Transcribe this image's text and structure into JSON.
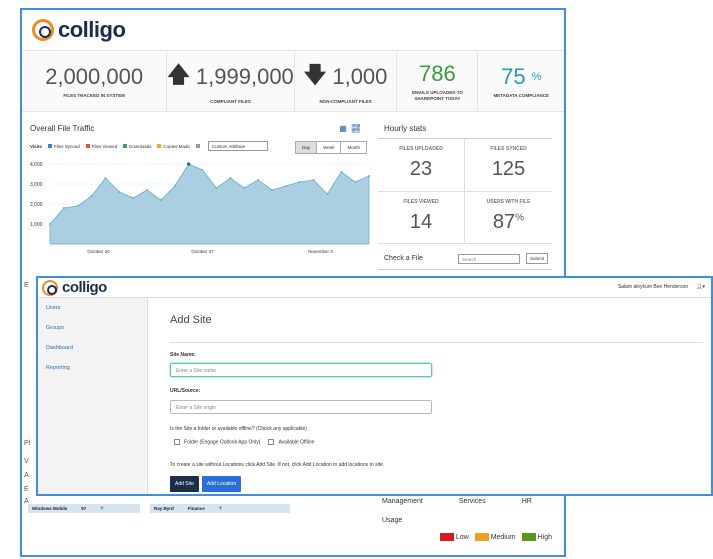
{
  "dashboard": {
    "logo": "colligo",
    "kpis": [
      {
        "value": "2,000,000",
        "label": "FILES TRACKED IN SYSTEM",
        "arrow": ""
      },
      {
        "value": "1,999,000",
        "label": "COMPLIANT FILES",
        "arrow": "🡅"
      },
      {
        "value": "1,000",
        "label": "NON-COMPLIANT FILES",
        "arrow": "🡇"
      },
      {
        "value": "786",
        "label": "EMAILS UPLOADED TO SHAREPOINT TODAY",
        "arrow": ""
      },
      {
        "value": "75",
        "suffix": "%",
        "label": "METADATA COMPLIANCE",
        "arrow": ""
      }
    ],
    "traffic": {
      "title": "Overall File Traffic",
      "legend_title": "Visits",
      "legend": [
        {
          "label": "Files Synced",
          "color": "#3a7bd5"
        },
        {
          "label": "Files Viewed",
          "color": "#e0533a"
        },
        {
          "label": "Downloads",
          "color": "#3aa35a"
        },
        {
          "label": "Copies Made",
          "color": "#f0a830"
        },
        {
          "label": "",
          "color": "#999999"
        }
      ],
      "attribute": "Custom Attribute",
      "ranges": [
        "Day",
        "Week",
        "Month"
      ]
    },
    "hourly": {
      "title": "Hourly stats",
      "cells": [
        {
          "label": "FILES UPLOADED",
          "value": "23",
          "suffix": ""
        },
        {
          "label": "FILES SYNCED",
          "value": "125",
          "suffix": ""
        },
        {
          "label": "FILES VIEWED",
          "value": "14",
          "suffix": ""
        },
        {
          "label": "USERS WITH FILE",
          "value": "87",
          "suffix": "%"
        }
      ],
      "check_label": "Check a File",
      "search_placeholder": "Search",
      "submit": "Submit"
    },
    "left_fragments": [
      "E",
      "Pl",
      "V",
      "A",
      "E",
      "A"
    ],
    "bottom_rows": [
      {
        "name": "Windows Mobile",
        "value": "97"
      },
      {
        "name": "Ray Byrd",
        "value": "Finance"
      }
    ],
    "usage": {
      "columns": [
        "Management",
        "Services",
        "HR"
      ],
      "label": "Usage",
      "legend": [
        {
          "label": "Low",
          "color": "#d91a1a"
        },
        {
          "label": "Medium",
          "color": "#f0a020"
        },
        {
          "label": "High",
          "color": "#5a9a1a"
        }
      ]
    }
  },
  "chart_data": {
    "type": "area",
    "x": [
      0,
      1,
      2,
      3,
      4,
      5,
      6,
      7,
      8,
      9,
      10,
      11,
      12,
      13,
      14,
      15,
      16,
      17,
      18,
      19,
      20,
      21,
      22,
      23
    ],
    "series": [
      {
        "values": [
          1000,
          1800,
          1900,
          2400,
          3300,
          2600,
          2300,
          2700,
          2200,
          2900,
          4000,
          3700,
          2800,
          3300,
          2800,
          3200,
          2700,
          2900,
          3100,
          3200,
          2500,
          3600,
          3100,
          3400
        ]
      }
    ],
    "yticks": [
      "1,000",
      "2,000",
      "3,000",
      "4,000"
    ],
    "xticks": [
      "October 20",
      "October 27",
      "November 3"
    ],
    "ylim": [
      0,
      4400
    ],
    "color": "#a9cfe0"
  },
  "modal": {
    "logo": "colligo",
    "user": "Salam aleykum Ben Henderson",
    "nav": [
      "Users",
      "Groups",
      "Dashboard",
      "Reporting"
    ],
    "title": "Add Site",
    "site_name_label": "Site Name:",
    "site_name_placeholder": "Enter a Site name",
    "url_label": "URL/Source:",
    "url_placeholder": "Enter a Site origin",
    "offline_question": "Is the Site a folder or available offline? (Check any applicable)",
    "options": [
      "Folder (Engage Outlook App Only)",
      "Available Offline"
    ],
    "instructions": "To create a site without Locations click Add Site. If not, click Add Location to add locations to site.",
    "add_site": "Add Site",
    "add_location": "Add Location"
  }
}
